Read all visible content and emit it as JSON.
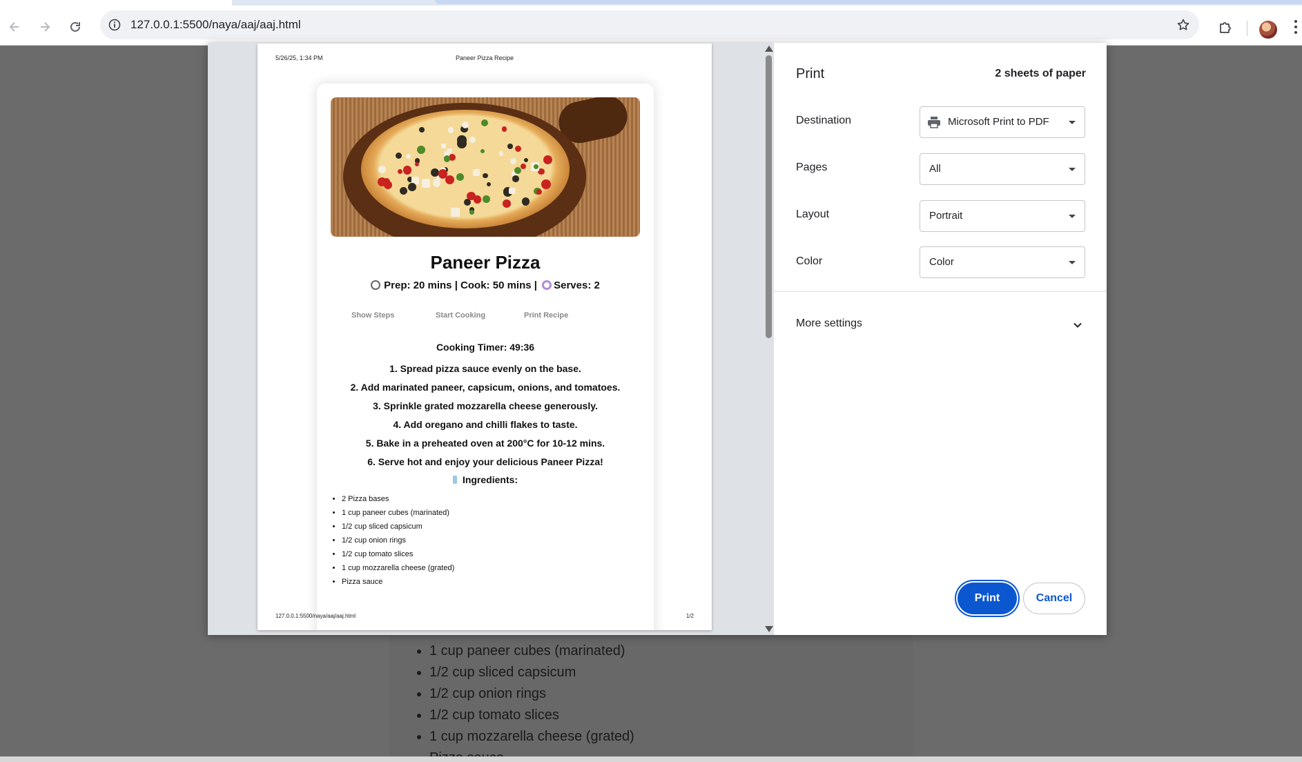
{
  "browser": {
    "url": "127.0.0.1:5500/naya/aaj/aaj.html"
  },
  "background_page": {
    "ingredients_partial": [
      "1 cup paneer cubes (marinated)",
      "1/2 cup sliced capsicum",
      "1/2 cup onion rings",
      "1/2 cup tomato slices",
      "1 cup mozzarella cheese (grated)",
      "Pizza sauce"
    ]
  },
  "preview": {
    "header_date": "5/26/25, 1:34 PM",
    "header_title": "Paneer Pizza Recipe",
    "footer_url": "127.0.0.1:5500/naya/aaj/aaj.html",
    "footer_page": "1/2",
    "recipe": {
      "title": "Paneer Pizza",
      "meta_prep": "Prep: 20 mins | Cook: 50 mins |",
      "meta_serves": "Serves: 2",
      "buttons": {
        "show_steps": "Show Steps",
        "start_cooking": "Start Cooking",
        "print_recipe": "Print Recipe"
      },
      "timer": "Cooking Timer: 49:36",
      "steps": [
        "1. Spread pizza sauce evenly on the base.",
        "2. Add marinated paneer, capsicum, onions, and tomatoes.",
        "3. Sprinkle grated mozzarella cheese generously.",
        "4. Add oregano and chilli flakes to taste.",
        "5. Bake in a preheated oven at 200°C for 10-12 mins.",
        "6. Serve hot and enjoy your delicious Paneer Pizza!"
      ],
      "ingredients_title": "Ingredients:",
      "ingredients": [
        "2 Pizza bases",
        "1 cup paneer cubes (marinated)",
        "1/2 cup sliced capsicum",
        "1/2 cup onion rings",
        "1/2 cup tomato slices",
        "1 cup mozzarella cheese (grated)",
        "Pizza sauce"
      ]
    }
  },
  "print_settings": {
    "title": "Print",
    "sheets": "2 sheets of paper",
    "destination_label": "Destination",
    "destination_value": "Microsoft Print to PDF",
    "pages_label": "Pages",
    "pages_value": "All",
    "layout_label": "Layout",
    "layout_value": "Portrait",
    "color_label": "Color",
    "color_value": "Color",
    "more_settings": "More settings",
    "print_button": "Print",
    "cancel_button": "Cancel"
  },
  "icons": {
    "back": "back-arrow-icon",
    "forward": "forward-arrow-icon",
    "reload": "reload-icon",
    "site_info": "info-icon",
    "bookmark": "star-icon",
    "extensions": "puzzle-icon",
    "printer": "printer-icon",
    "expand": "chevron-down-icon"
  },
  "colors": {
    "accent": "#0b57d0",
    "preview_bg": "#dee1e6",
    "scrim": "#6b6b6b"
  }
}
